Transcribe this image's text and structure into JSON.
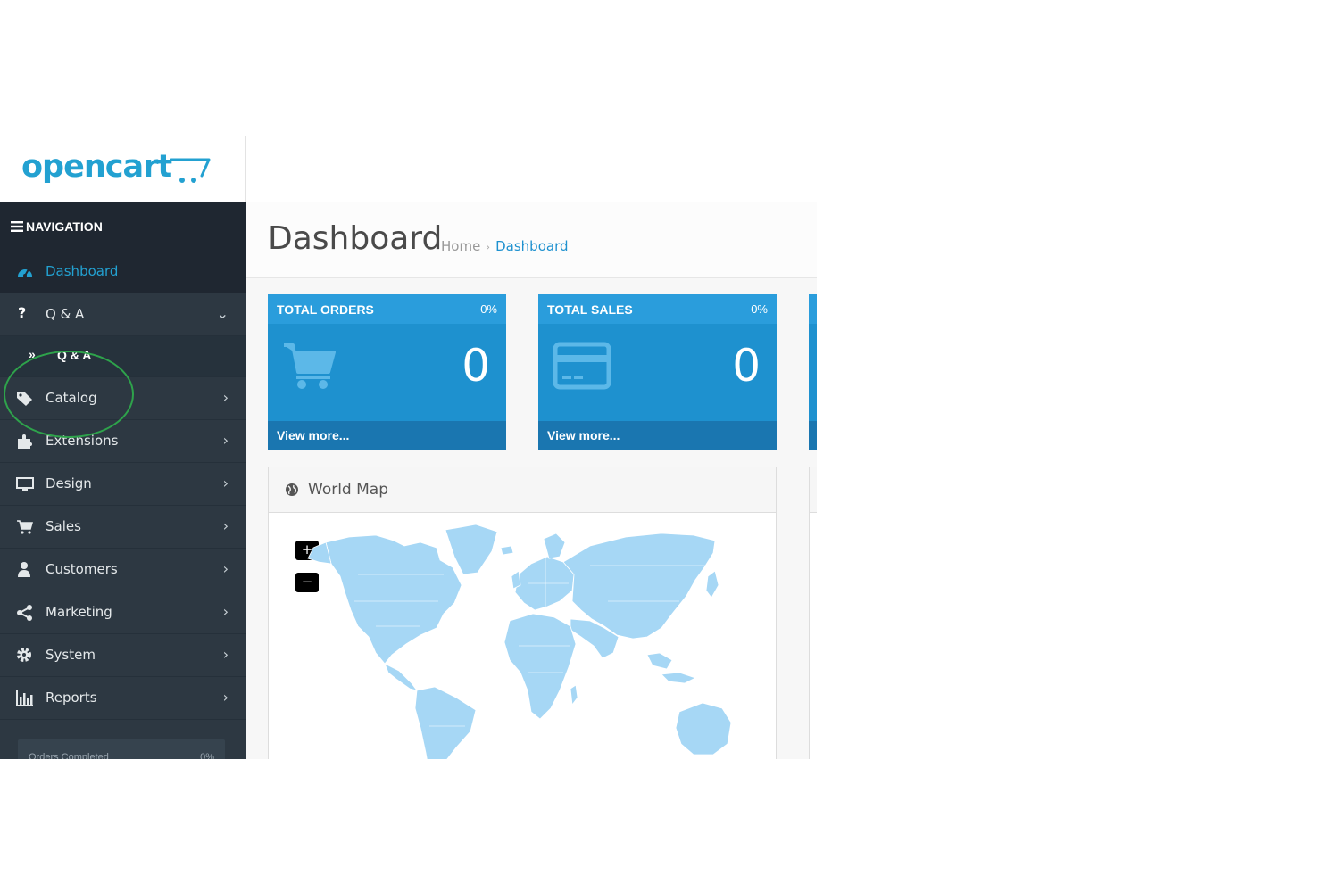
{
  "header": {
    "logo_text": "opencart"
  },
  "sidebar": {
    "nav_title": "NAVIGATION",
    "items": [
      {
        "label": "Dashboard",
        "icon": "dashboard-icon",
        "active": true
      },
      {
        "label": "Q & A",
        "icon": "question-icon",
        "expanded": true
      },
      {
        "label": "Catalog",
        "icon": "tags-icon"
      },
      {
        "label": "Extensions",
        "icon": "puzzle-icon"
      },
      {
        "label": "Design",
        "icon": "monitor-icon"
      },
      {
        "label": "Sales",
        "icon": "cart-icon"
      },
      {
        "label": "Customers",
        "icon": "user-icon"
      },
      {
        "label": "Marketing",
        "icon": "share-icon"
      },
      {
        "label": "System",
        "icon": "cog-icon"
      },
      {
        "label": "Reports",
        "icon": "bar-chart-icon"
      }
    ],
    "subitem": {
      "label": "Q & A"
    },
    "progress": {
      "label": "Orders Completed",
      "value": "0%"
    }
  },
  "main": {
    "title": "Dashboard",
    "breadcrumb": {
      "home": "Home",
      "current": "Dashboard"
    },
    "tiles": [
      {
        "title": "TOTAL ORDERS",
        "percent": "0%",
        "value": "0",
        "link": "View more..."
      },
      {
        "title": "TOTAL SALES",
        "percent": "0%",
        "value": "0",
        "link": "View more..."
      }
    ],
    "map": {
      "title": "World Map",
      "zoom_in": "+",
      "zoom_out": "−"
    }
  },
  "colors": {
    "accent": "#23a1d1",
    "sidebar_bg": "#2d3842",
    "tile_bg": "#1e91cf",
    "map_land": "#a6d7f5",
    "annotation_circle": "#2ea34b"
  }
}
